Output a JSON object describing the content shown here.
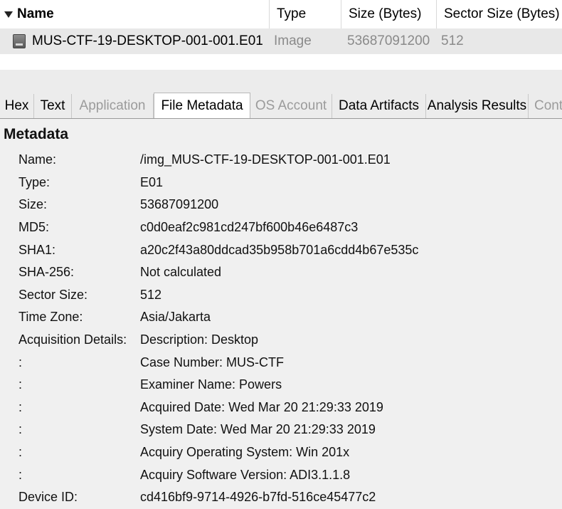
{
  "table": {
    "columns": {
      "name": "Name",
      "type": "Type",
      "size": "Size (Bytes)",
      "sector": "Sector Size (Bytes)"
    },
    "rows": [
      {
        "icon": "disk-image-icon",
        "name": "MUS-CTF-19-DESKTOP-001-001.E01",
        "type": "Image",
        "size": "53687091200",
        "sector": "512"
      }
    ]
  },
  "tabs": [
    {
      "label": "Hex",
      "enabled": true
    },
    {
      "label": "Text",
      "enabled": true
    },
    {
      "label": "Application",
      "enabled": false
    },
    {
      "label": "File Metadata",
      "enabled": true,
      "active": true
    },
    {
      "label": "OS Account",
      "enabled": false
    },
    {
      "label": "Data Artifacts",
      "enabled": true
    },
    {
      "label": "Analysis Results",
      "enabled": true
    },
    {
      "label": "Cont",
      "enabled": false
    }
  ],
  "metadata": {
    "heading": "Metadata",
    "rows": [
      {
        "key": "Name:",
        "value": "/img_MUS-CTF-19-DESKTOP-001-001.E01"
      },
      {
        "key": "Type:",
        "value": "E01"
      },
      {
        "key": "Size:",
        "value": "53687091200"
      },
      {
        "key": "MD5:",
        "value": "c0d0eaf2c981cd247bf600b46e6487c3"
      },
      {
        "key": "SHA1:",
        "value": "a20c2f43a80ddcad35b958b701a6cdd4b67e535c"
      },
      {
        "key": "SHA-256:",
        "value": "Not calculated"
      },
      {
        "key": "Sector Size:",
        "value": "512"
      },
      {
        "key": "Time Zone:",
        "value": "Asia/Jakarta"
      },
      {
        "key": "Acquisition Details:",
        "value": "Description: Desktop"
      },
      {
        "key": ":",
        "value": "Case Number: MUS-CTF"
      },
      {
        "key": ":",
        "value": "Examiner Name: Powers"
      },
      {
        "key": ":",
        "value": "Acquired Date: Wed Mar 20 21:29:33 2019"
      },
      {
        "key": ":",
        "value": "System Date: Wed Mar 20 21:29:33 2019"
      },
      {
        "key": ":",
        "value": "Acquiry Operating System: Win 201x"
      },
      {
        "key": ":",
        "value": "Acquiry Software Version: ADI3.1.1.8"
      },
      {
        "key": "Device ID:",
        "value": "cd416bf9-9714-4926-b7fd-516ce45477c2"
      }
    ]
  }
}
